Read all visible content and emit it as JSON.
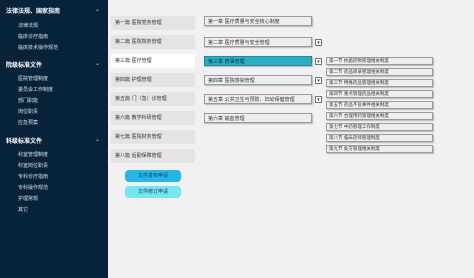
{
  "sidebar": {
    "sections": [
      {
        "title": "法律法规、国家指南",
        "items": [
          "法律法规",
          "临床诊疗指南",
          "临床技术操作规范"
        ]
      },
      {
        "title": "院级标准文件",
        "items": [
          "医院管理制度",
          "委员会工作制度",
          "部门职能",
          "岗位职责",
          "应急预案"
        ]
      },
      {
        "title": "科级标准文件",
        "items": [
          "科室管理制度",
          "科室岗位职责",
          "专科诊疗指南",
          "专科操作规范",
          "护理常规",
          "其它"
        ]
      }
    ]
  },
  "parts": [
    "第一篇 医院党务管理",
    "第二篇 医院院务管理",
    "第三篇 医疗管理",
    "第四篇 护理管理",
    "第五篇 门（急）诊管理",
    "第六篇 教学科研管理",
    "第七篇 医院财务管理",
    "第八篇 后勤保障管理"
  ],
  "chapters": [
    "第一章 医疗质量与安全核心制度",
    "第二章 医疗质量与安全管理",
    "第三章 药事管理",
    "第四章 医院感染管理",
    "第五章 公共卫生与预防、妇幼保健管理",
    "第六章 输血管理"
  ],
  "sections": [
    "第一节 抗菌药物管理相关制度",
    "第二节 药品目录管理相关制度",
    "第三节 特殊药品管理相关制度",
    "第四节 重点管理药品相关制度",
    "第五节 药品不良事件相关制度",
    "第六节 合理用药管理相关制度",
    "第七节 中药管理工作制度",
    "第八节 临床药师管理制度",
    "第九节 处方管理相关制度"
  ],
  "buttons": {
    "apply": "文件发布申请",
    "revise": "文件修订申请"
  },
  "dropdown_glyph": "▾",
  "colors": {
    "sidebar": "#06233a",
    "selected": "#29b0c4",
    "button1": "#22b8e8",
    "button2": "#73e6f4"
  }
}
